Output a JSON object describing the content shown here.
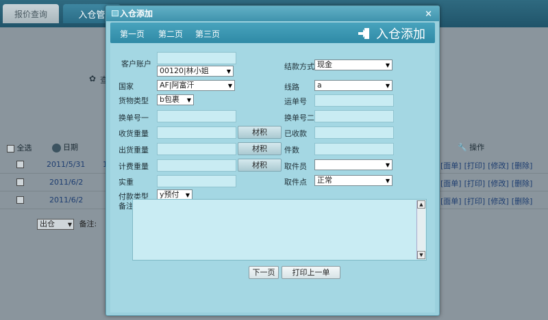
{
  "background": {
    "tabs": [
      "报价查询",
      "入仓管"
    ],
    "partial_label": "查",
    "table": {
      "select_all": "全选",
      "date_header": "日期",
      "ops_header": "操作",
      "rows": [
        {
          "date": "2011/5/31",
          "extra": "1",
          "actions": [
            "[面单]",
            "[打印]",
            "[修改]",
            "[删除]"
          ]
        },
        {
          "date": "2011/6/2",
          "extra": "",
          "actions": [
            "[面单]",
            "[打印]",
            "[修改]",
            "[删除]"
          ]
        },
        {
          "date": "2011/6/2",
          "extra": "",
          "actions": [
            "[面单]",
            "[打印]",
            "[修改]",
            "[删除]"
          ]
        }
      ]
    },
    "bottom": {
      "select_value": "出仓",
      "remark_label": "备注:"
    }
  },
  "dialog": {
    "title": "入仓添加",
    "close": "×",
    "tabs": [
      "第一页",
      "第二页",
      "第三页"
    ],
    "big_title": "入仓添加",
    "fields": {
      "customer_account": {
        "label": "客户账户",
        "value": "",
        "select": "00120|林小姐"
      },
      "settlement": {
        "label": "结款方式",
        "select": "现金"
      },
      "country": {
        "label": "国家",
        "select": "AF|阿富汗"
      },
      "route": {
        "label": "线路",
        "select": "a"
      },
      "cargo_type": {
        "label": "货物类型",
        "select": "b包裹"
      },
      "waybill": {
        "label": "运单号",
        "value": ""
      },
      "exchange1": {
        "label": "换单号一",
        "value": ""
      },
      "exchange2": {
        "label": "换单号二",
        "value": ""
      },
      "recv_weight": {
        "label": "收货重量",
        "value": ""
      },
      "received": {
        "label": "已收款",
        "value": ""
      },
      "ship_weight": {
        "label": "出货重量",
        "value": ""
      },
      "pieces": {
        "label": "件数",
        "value": ""
      },
      "bill_weight": {
        "label": "计费重量",
        "value": ""
      },
      "picker": {
        "label": "取件员",
        "select": ""
      },
      "actual_weight": {
        "label": "实重",
        "value": ""
      },
      "pickup_point": {
        "label": "取件点",
        "select": "正常"
      },
      "pay_type": {
        "label": "付款类型",
        "select": "y预付"
      },
      "remarks": {
        "label": "备注",
        "value": ""
      }
    },
    "volume_btn": "材积",
    "next_btn": "下一页",
    "print_btn": "打印上一单"
  }
}
